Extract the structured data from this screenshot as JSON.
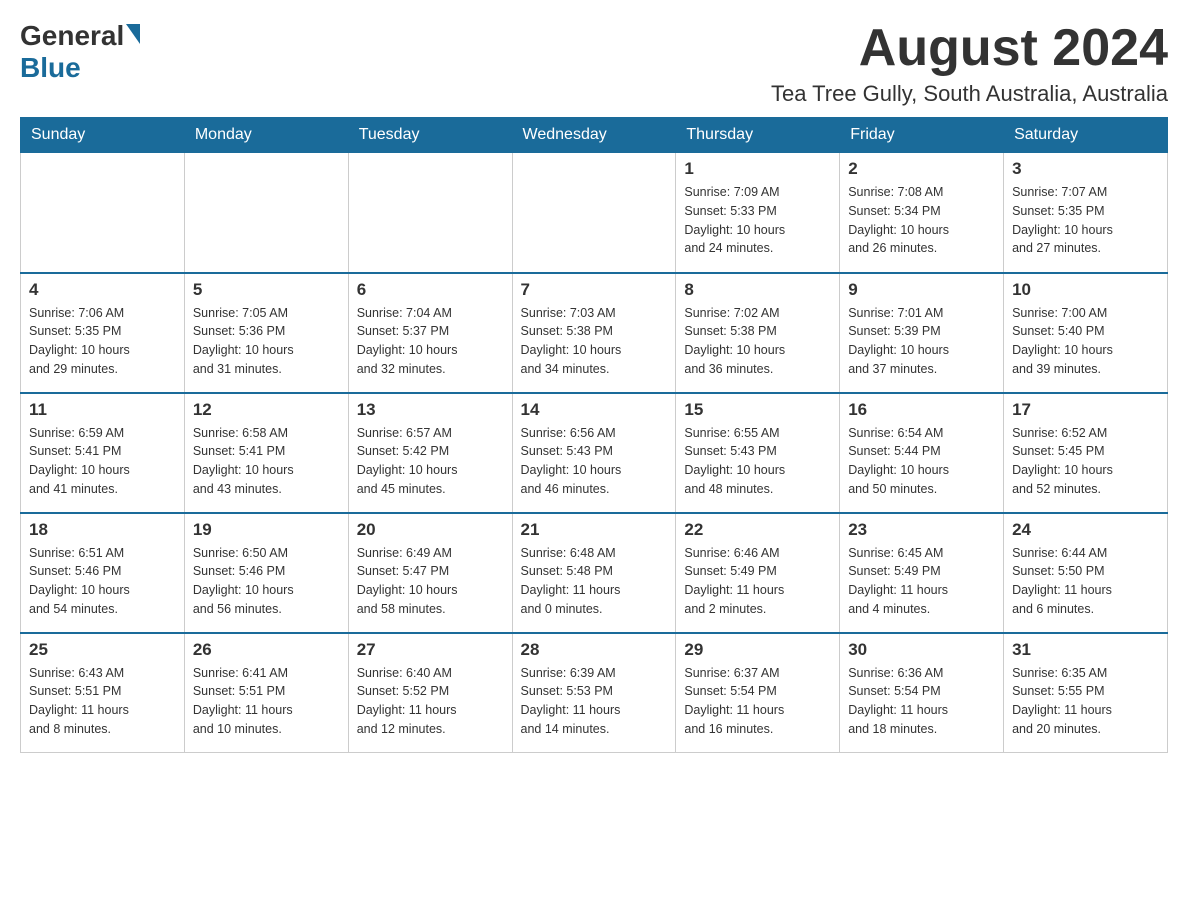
{
  "header": {
    "logo_general": "General",
    "logo_blue": "Blue",
    "month_title": "August 2024",
    "location": "Tea Tree Gully, South Australia, Australia"
  },
  "weekdays": [
    "Sunday",
    "Monday",
    "Tuesday",
    "Wednesday",
    "Thursday",
    "Friday",
    "Saturday"
  ],
  "weeks": [
    [
      {
        "day": "",
        "info": ""
      },
      {
        "day": "",
        "info": ""
      },
      {
        "day": "",
        "info": ""
      },
      {
        "day": "",
        "info": ""
      },
      {
        "day": "1",
        "info": "Sunrise: 7:09 AM\nSunset: 5:33 PM\nDaylight: 10 hours\nand 24 minutes."
      },
      {
        "day": "2",
        "info": "Sunrise: 7:08 AM\nSunset: 5:34 PM\nDaylight: 10 hours\nand 26 minutes."
      },
      {
        "day": "3",
        "info": "Sunrise: 7:07 AM\nSunset: 5:35 PM\nDaylight: 10 hours\nand 27 minutes."
      }
    ],
    [
      {
        "day": "4",
        "info": "Sunrise: 7:06 AM\nSunset: 5:35 PM\nDaylight: 10 hours\nand 29 minutes."
      },
      {
        "day": "5",
        "info": "Sunrise: 7:05 AM\nSunset: 5:36 PM\nDaylight: 10 hours\nand 31 minutes."
      },
      {
        "day": "6",
        "info": "Sunrise: 7:04 AM\nSunset: 5:37 PM\nDaylight: 10 hours\nand 32 minutes."
      },
      {
        "day": "7",
        "info": "Sunrise: 7:03 AM\nSunset: 5:38 PM\nDaylight: 10 hours\nand 34 minutes."
      },
      {
        "day": "8",
        "info": "Sunrise: 7:02 AM\nSunset: 5:38 PM\nDaylight: 10 hours\nand 36 minutes."
      },
      {
        "day": "9",
        "info": "Sunrise: 7:01 AM\nSunset: 5:39 PM\nDaylight: 10 hours\nand 37 minutes."
      },
      {
        "day": "10",
        "info": "Sunrise: 7:00 AM\nSunset: 5:40 PM\nDaylight: 10 hours\nand 39 minutes."
      }
    ],
    [
      {
        "day": "11",
        "info": "Sunrise: 6:59 AM\nSunset: 5:41 PM\nDaylight: 10 hours\nand 41 minutes."
      },
      {
        "day": "12",
        "info": "Sunrise: 6:58 AM\nSunset: 5:41 PM\nDaylight: 10 hours\nand 43 minutes."
      },
      {
        "day": "13",
        "info": "Sunrise: 6:57 AM\nSunset: 5:42 PM\nDaylight: 10 hours\nand 45 minutes."
      },
      {
        "day": "14",
        "info": "Sunrise: 6:56 AM\nSunset: 5:43 PM\nDaylight: 10 hours\nand 46 minutes."
      },
      {
        "day": "15",
        "info": "Sunrise: 6:55 AM\nSunset: 5:43 PM\nDaylight: 10 hours\nand 48 minutes."
      },
      {
        "day": "16",
        "info": "Sunrise: 6:54 AM\nSunset: 5:44 PM\nDaylight: 10 hours\nand 50 minutes."
      },
      {
        "day": "17",
        "info": "Sunrise: 6:52 AM\nSunset: 5:45 PM\nDaylight: 10 hours\nand 52 minutes."
      }
    ],
    [
      {
        "day": "18",
        "info": "Sunrise: 6:51 AM\nSunset: 5:46 PM\nDaylight: 10 hours\nand 54 minutes."
      },
      {
        "day": "19",
        "info": "Sunrise: 6:50 AM\nSunset: 5:46 PM\nDaylight: 10 hours\nand 56 minutes."
      },
      {
        "day": "20",
        "info": "Sunrise: 6:49 AM\nSunset: 5:47 PM\nDaylight: 10 hours\nand 58 minutes."
      },
      {
        "day": "21",
        "info": "Sunrise: 6:48 AM\nSunset: 5:48 PM\nDaylight: 11 hours\nand 0 minutes."
      },
      {
        "day": "22",
        "info": "Sunrise: 6:46 AM\nSunset: 5:49 PM\nDaylight: 11 hours\nand 2 minutes."
      },
      {
        "day": "23",
        "info": "Sunrise: 6:45 AM\nSunset: 5:49 PM\nDaylight: 11 hours\nand 4 minutes."
      },
      {
        "day": "24",
        "info": "Sunrise: 6:44 AM\nSunset: 5:50 PM\nDaylight: 11 hours\nand 6 minutes."
      }
    ],
    [
      {
        "day": "25",
        "info": "Sunrise: 6:43 AM\nSunset: 5:51 PM\nDaylight: 11 hours\nand 8 minutes."
      },
      {
        "day": "26",
        "info": "Sunrise: 6:41 AM\nSunset: 5:51 PM\nDaylight: 11 hours\nand 10 minutes."
      },
      {
        "day": "27",
        "info": "Sunrise: 6:40 AM\nSunset: 5:52 PM\nDaylight: 11 hours\nand 12 minutes."
      },
      {
        "day": "28",
        "info": "Sunrise: 6:39 AM\nSunset: 5:53 PM\nDaylight: 11 hours\nand 14 minutes."
      },
      {
        "day": "29",
        "info": "Sunrise: 6:37 AM\nSunset: 5:54 PM\nDaylight: 11 hours\nand 16 minutes."
      },
      {
        "day": "30",
        "info": "Sunrise: 6:36 AM\nSunset: 5:54 PM\nDaylight: 11 hours\nand 18 minutes."
      },
      {
        "day": "31",
        "info": "Sunrise: 6:35 AM\nSunset: 5:55 PM\nDaylight: 11 hours\nand 20 minutes."
      }
    ]
  ]
}
